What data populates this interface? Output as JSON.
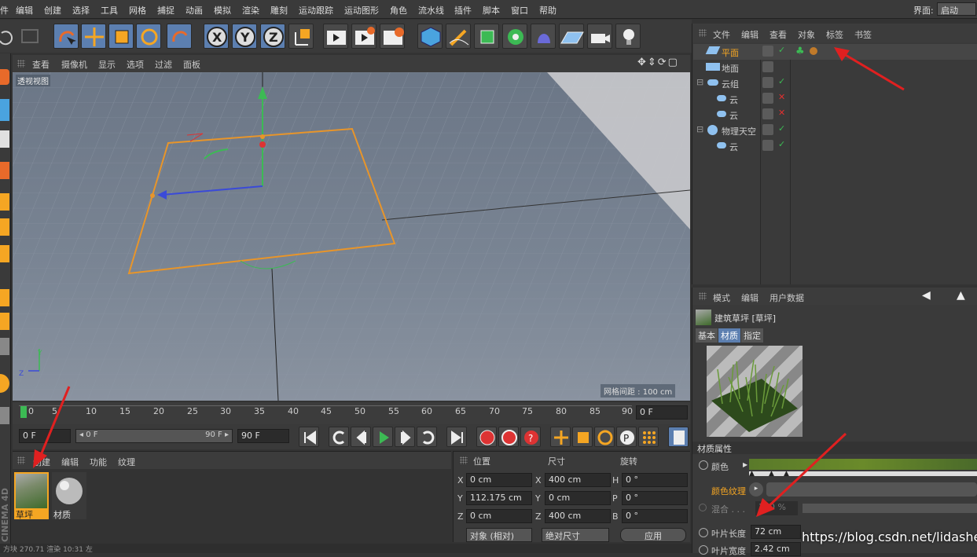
{
  "menubar": {
    "items": [
      "件",
      "编辑",
      "创建",
      "选择",
      "工具",
      "网格",
      "捕捉",
      "动画",
      "模拟",
      "渲染",
      "雕刻",
      "运动跟踪",
      "运动图形",
      "角色",
      "流水线",
      "插件",
      "脚本",
      "窗口",
      "帮助"
    ],
    "layout_label": "界面:",
    "layout_value": "启动"
  },
  "viewport": {
    "menu": [
      "查看",
      "摄像机",
      "显示",
      "选项",
      "过滤",
      "面板"
    ],
    "label": "透视视图",
    "grid_info": "网格间距 : 100 cm"
  },
  "timeline": {
    "ticks": [
      "0",
      "5",
      "10",
      "15",
      "20",
      "25",
      "30",
      "35",
      "40",
      "45",
      "50",
      "55",
      "60",
      "65",
      "70",
      "75",
      "80",
      "85",
      "90"
    ],
    "current_frame": "0 F",
    "start_frame": "0 F",
    "range_start": "◂ 0 F",
    "range_end": "90 F ▸",
    "end_frame": "90 F"
  },
  "material_manager": {
    "menu": [
      "创建",
      "编辑",
      "功能",
      "纹理"
    ],
    "materials": [
      {
        "name": "草坪",
        "selected": true
      },
      {
        "name": "材质",
        "selected": false
      }
    ]
  },
  "coordinates": {
    "headers": [
      "位置",
      "尺寸",
      "旋转"
    ],
    "rows": [
      {
        "a": "X",
        "pos": "0 cm",
        "b": "X",
        "size": "400 cm",
        "c": "H",
        "rot": "0 °"
      },
      {
        "a": "Y",
        "pos": "112.175 cm",
        "b": "Y",
        "size": "0 cm",
        "c": "P",
        "rot": "0 °"
      },
      {
        "a": "Z",
        "pos": "0 cm",
        "b": "Z",
        "size": "400 cm",
        "c": "B",
        "rot": "0 °"
      }
    ],
    "mode": "对象 (相对)",
    "size_mode": "绝对尺寸",
    "apply": "应用"
  },
  "object_manager": {
    "menu": [
      "文件",
      "编辑",
      "查看",
      "对象",
      "标签",
      "书签"
    ],
    "objects": [
      {
        "name": "平面",
        "indent": 0,
        "status": "✓",
        "selected": true
      },
      {
        "name": "地面",
        "indent": 0,
        "status": ""
      },
      {
        "name": "云组",
        "indent": 0,
        "status": "✓"
      },
      {
        "name": "云",
        "indent": 1,
        "status": "✕"
      },
      {
        "name": "云",
        "indent": 1,
        "status": "✕"
      },
      {
        "name": "物理天空",
        "indent": 0,
        "status": "✓"
      },
      {
        "name": "云",
        "indent": 1,
        "status": "✓"
      }
    ]
  },
  "attributes": {
    "menu": [
      "模式",
      "编辑",
      "用户数据"
    ],
    "material_title": "建筑草坪 [草坪]",
    "tabs": [
      "基本",
      "材质",
      "指定"
    ],
    "section": "材质属性",
    "props": {
      "color": "颜色",
      "color_texture": "颜色纹理",
      "mix": "混合 . . .",
      "mix_value": "100 %",
      "blade_length": "叶片长度",
      "blade_length_value": "72 cm",
      "blade_width": "叶片宽度",
      "blade_width_value": "2.42 cm"
    }
  },
  "statusbar": {
    "text": "方块 270.71  渲染  10:31 左"
  },
  "watermark": "https://blog.csdn.net/lidashent",
  "side_label": "CINEMA 4D"
}
